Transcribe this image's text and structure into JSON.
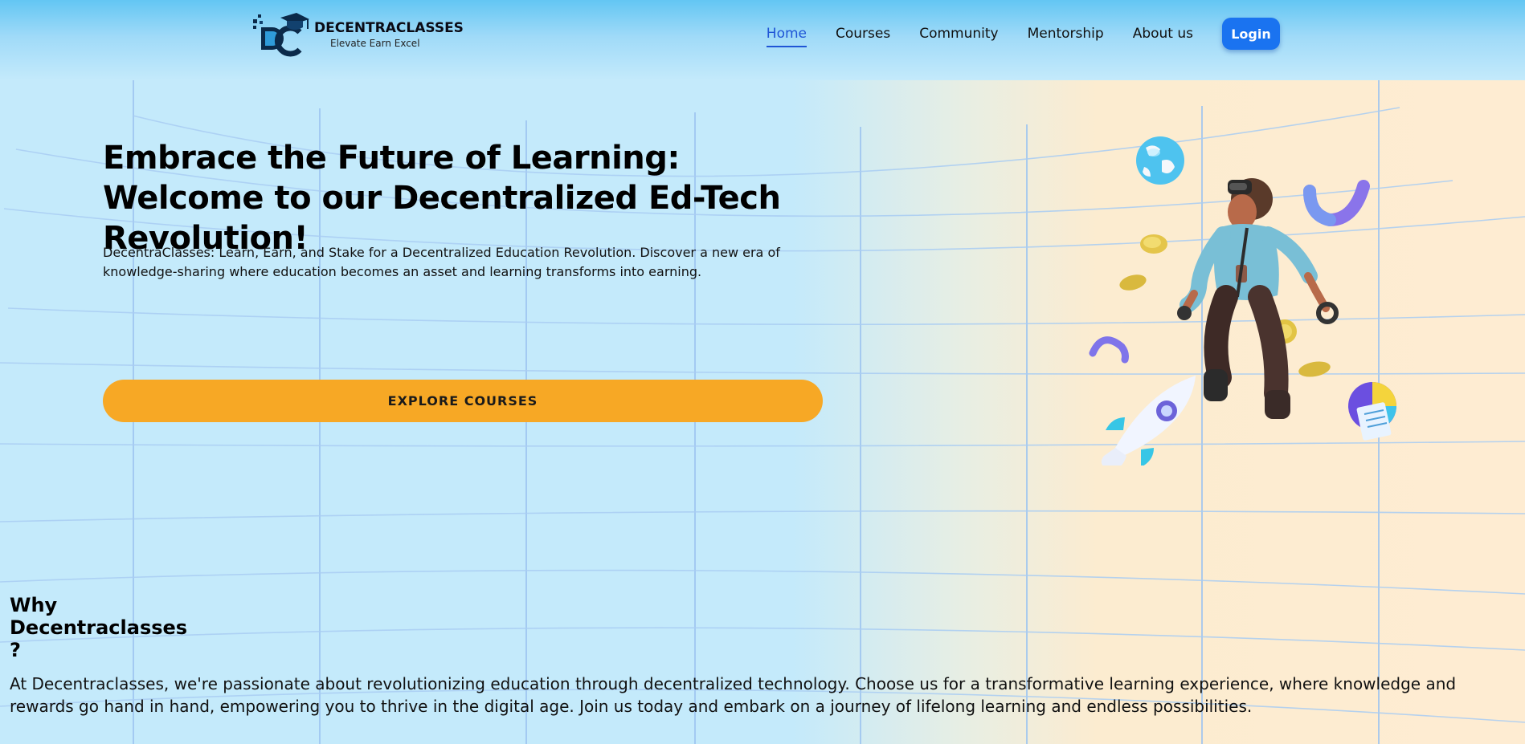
{
  "brand": {
    "name": "DECENTRACLASSES",
    "tagline": "Elevate Earn Excel",
    "accent_color": "#1a73f0"
  },
  "nav": {
    "items": [
      {
        "label": "Home",
        "active": true
      },
      {
        "label": "Courses",
        "active": false
      },
      {
        "label": "Community",
        "active": false
      },
      {
        "label": "Mentorship",
        "active": false
      },
      {
        "label": "About us",
        "active": false
      }
    ],
    "login_label": "Login"
  },
  "hero": {
    "title": "Embrace the Future of Learning: Welcome to our Decentralized Ed-Tech Revolution!",
    "subtitle": "DecentraClasses: Learn, Earn, and Stake for a Decentralized Education Revolution. Discover a new era of knowledge-sharing where education becomes an asset and learning transforms into earning.",
    "cta_label": "EXPLORE COURSES",
    "cta_color": "#f7a825",
    "illustration_icons": [
      "globe-icon",
      "vr-headset-character",
      "coin-icon",
      "rocket-icon",
      "pie-chart-icon",
      "magnet-shape-icon"
    ]
  },
  "why": {
    "title": "Why Decentraclasses ?",
    "text": "At Decentraclasses, we're passionate about revolutionizing education through decentralized technology. Choose us for a transformative learning experience, where knowledge and rewards go hand in hand, empowering you to thrive in the digital age. Join us today and embark on a journey of lifelong learning and endless possibilities."
  }
}
